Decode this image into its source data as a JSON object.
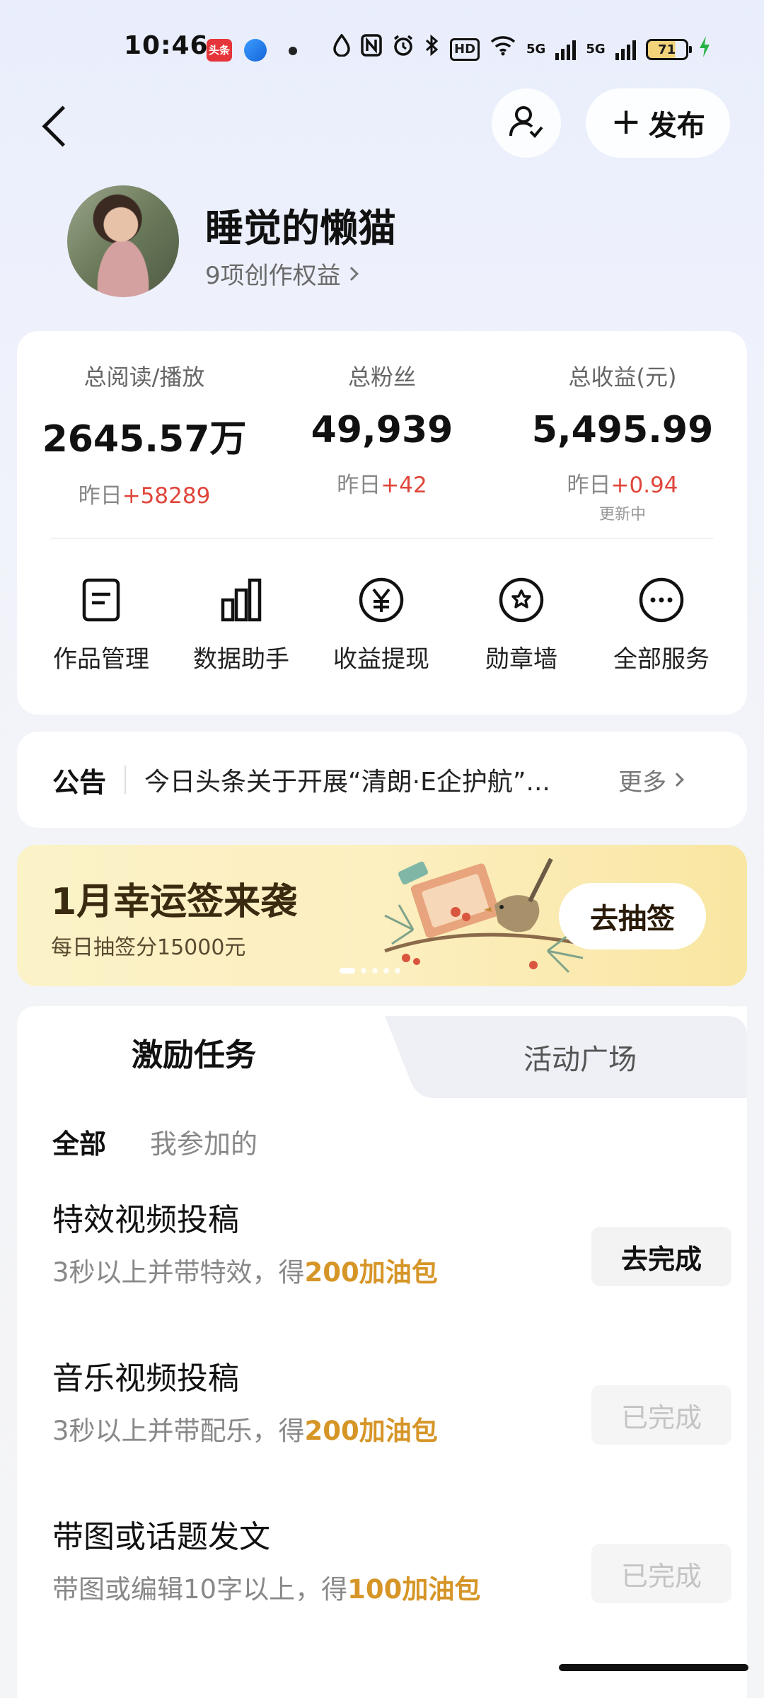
{
  "status_bar": {
    "time": "10:46",
    "app_badge": "头条",
    "battery": "71",
    "hd_label": "HD",
    "network_1": "5G",
    "network_2": "5G"
  },
  "header": {
    "publish_label": "发布"
  },
  "profile": {
    "username": "睡觉的懒猫",
    "benefits_label": "9项创作权益"
  },
  "stats": [
    {
      "label": "总阅读/播放",
      "value": "2645.57万",
      "change_prefix": "昨日",
      "change_delta": "+58289",
      "sub": ""
    },
    {
      "label": "总粉丝",
      "value": "49,939",
      "change_prefix": "昨日",
      "change_delta": "+42",
      "sub": ""
    },
    {
      "label": "总收益(元)",
      "value": "5,495.99",
      "change_prefix": "昨日",
      "change_delta": "+0.94",
      "sub": "更新中"
    }
  ],
  "services": [
    {
      "label": "作品管理",
      "icon": "document-icon"
    },
    {
      "label": "数据助手",
      "icon": "bar-chart-icon"
    },
    {
      "label": "收益提现",
      "icon": "yen-icon"
    },
    {
      "label": "勋章墙",
      "icon": "badge-icon"
    },
    {
      "label": "全部服务",
      "icon": "more-icon"
    }
  ],
  "notice": {
    "title": "公告",
    "text": "今日头条关于开展“清朗·E企护航”...",
    "more": "更多"
  },
  "banner": {
    "title": "1月幸运签来袭",
    "subtitle": "每日抽签分15000元",
    "button": "去抽签"
  },
  "tasks": {
    "tab_active": "激励任务",
    "tab_other": "活动广场",
    "filters": [
      "全部",
      "我参加的"
    ],
    "items": [
      {
        "title": "特效视频投稿",
        "desc": "3秒以上并带特效，得",
        "reward": "200加油包",
        "button": "去完成",
        "state": "todo"
      },
      {
        "title": "音乐视频投稿",
        "desc": "3秒以上并带配乐，得",
        "reward": "200加油包",
        "button": "已完成",
        "state": "done"
      },
      {
        "title": "带图或话题发文",
        "desc": "带图或编辑10字以上，得",
        "reward": "100加油包",
        "button": "已完成",
        "state": "done"
      }
    ]
  },
  "colors": {
    "accent_red": "#e0453b",
    "reward_gold": "#d69527",
    "banner_bg": "#fcefc0"
  }
}
